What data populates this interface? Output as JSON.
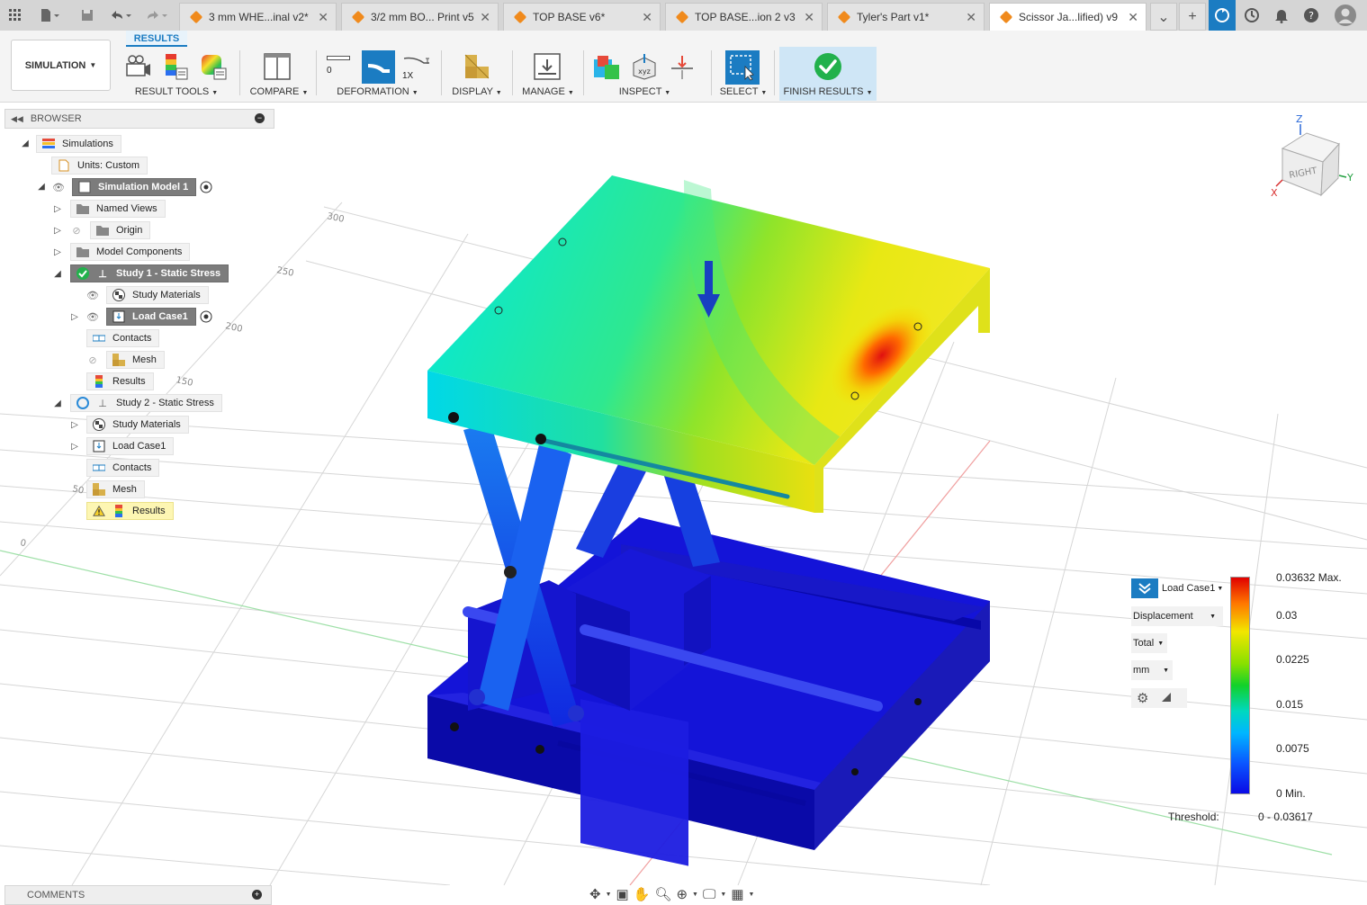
{
  "tabs": [
    {
      "title": "3 mm WHE...inal v2*",
      "active": false
    },
    {
      "title": "3/2 mm BO... Print v5",
      "active": false
    },
    {
      "title": "TOP BASE v6*",
      "active": false
    },
    {
      "title": "TOP BASE...ion 2 v3",
      "active": false
    },
    {
      "title": "Tyler's Part v1*",
      "active": false
    },
    {
      "title": "Scissor Ja...lified) v9",
      "active": true
    }
  ],
  "ribbon": {
    "workspace": "SIMULATION",
    "active_tab": "RESULTS",
    "groups": {
      "result_tools": "RESULT TOOLS",
      "compare": "COMPARE",
      "deformation": "DEFORMATION",
      "display": "DISPLAY",
      "manage": "MANAGE",
      "inspect": "INSPECT",
      "select": "SELECT",
      "finish": "FINISH RESULTS"
    },
    "deform_zero": "0",
    "deform_1x": "1X"
  },
  "browser": {
    "title": "BROWSER",
    "items": {
      "simulations": "Simulations",
      "units": "Units: Custom",
      "sim_model": "Simulation Model 1",
      "named_views": "Named Views",
      "origin": "Origin",
      "model_components": "Model Components",
      "study1": "Study 1 - Static Stress",
      "study1_materials": "Study Materials",
      "study1_loadcase": "Load Case1",
      "study1_contacts": "Contacts",
      "study1_mesh": "Mesh",
      "study1_results": "Results",
      "study2": "Study 2 - Static Stress",
      "study2_materials": "Study Materials",
      "study2_loadcase": "Load Case1",
      "study2_contacts": "Contacts",
      "study2_mesh": "Mesh",
      "study2_results": "Results"
    }
  },
  "viewcube": {
    "face": "RIGHT",
    "axis_z": "Z",
    "axis_y": "Y",
    "axis_x": "X"
  },
  "grid_labels": [
    "300",
    "250",
    "200",
    "150",
    "50",
    "0"
  ],
  "legend": {
    "load_case": "Load Case1",
    "result_type": "Displacement",
    "component": "Total",
    "unit": "mm",
    "ticks": [
      "0.03632 Max.",
      "0.03",
      "0.0225",
      "0.015",
      "0.0075",
      "0 Min."
    ],
    "threshold_label": "Threshold:",
    "threshold_value": "0 - 0.03617"
  },
  "comments": {
    "title": "COMMENTS"
  },
  "colors": {
    "accent": "#1b7cc2",
    "finish_green": "#22b14c",
    "ribbon_bg": "#f4f4f4"
  }
}
